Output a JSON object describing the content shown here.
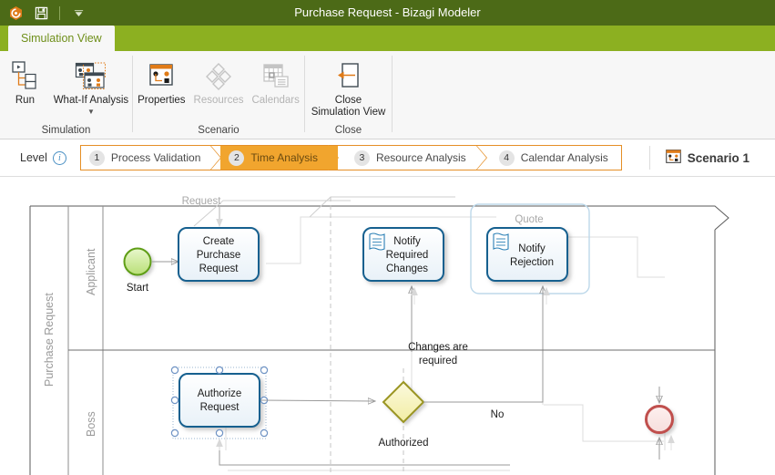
{
  "window": {
    "title": "Purchase Request - Bizagi Modeler",
    "quick_access": [
      {
        "name": "app-logo-icon",
        "label": "Bizagi"
      },
      {
        "name": "save-icon",
        "label": "Save"
      },
      {
        "name": "customize-qat-icon",
        "label": "Customize Quick Access Toolbar"
      }
    ]
  },
  "tabs": [
    {
      "label": "Simulation View",
      "active": true
    }
  ],
  "ribbon": {
    "groups": [
      {
        "label": "Simulation",
        "buttons": [
          {
            "label": "Run",
            "icon": "run-icon",
            "enabled": true,
            "dropdown": false
          },
          {
            "label": "What-If Analysis",
            "icon": "what-if-analysis-icon",
            "enabled": true,
            "dropdown": true
          }
        ]
      },
      {
        "label": "Scenario",
        "buttons": [
          {
            "label": "Properties",
            "icon": "properties-icon",
            "enabled": true,
            "dropdown": false
          },
          {
            "label": "Resources",
            "icon": "resources-icon",
            "enabled": false,
            "dropdown": false
          },
          {
            "label": "Calendars",
            "icon": "calendars-icon",
            "enabled": false,
            "dropdown": false
          }
        ]
      },
      {
        "label": "Close",
        "buttons": [
          {
            "label": "Close\nSimulation View",
            "line1": "Close",
            "line2": "Simulation View",
            "icon": "close-simulation-view-icon",
            "enabled": true,
            "dropdown": false
          }
        ]
      }
    ]
  },
  "level_bar": {
    "label": "Level",
    "info_icon": "info-icon",
    "steps": [
      {
        "num": "1",
        "label": "Process Validation",
        "active": false
      },
      {
        "num": "2",
        "label": "Time Analysis",
        "active": true
      },
      {
        "num": "3",
        "label": "Resource Analysis",
        "active": false
      },
      {
        "num": "4",
        "label": "Calendar Analysis",
        "active": false
      }
    ],
    "scenario": {
      "icon": "scenario-icon",
      "label": "Scenario 1"
    }
  },
  "diagram": {
    "pool": {
      "name": "Purchase Request"
    },
    "lanes": [
      {
        "name": "Applicant"
      },
      {
        "name": "Boss"
      }
    ],
    "groups": [
      {
        "name": "Request"
      },
      {
        "name": "Quote"
      }
    ],
    "events": [
      {
        "name": "Start",
        "label": "Start",
        "type": "start",
        "color": "#9fd14a"
      },
      {
        "name": "End",
        "label": "",
        "type": "end",
        "color": "#c0504d"
      }
    ],
    "tasks": [
      {
        "name": "Create Purchase Request",
        "lines": [
          "Create",
          "Purchase",
          "Request"
        ],
        "type": "user",
        "selected": false
      },
      {
        "name": "Notify Required Changes",
        "lines": [
          "Notify",
          "Required",
          "Changes"
        ],
        "type": "script",
        "selected": false
      },
      {
        "name": "Notify Rejection",
        "lines": [
          "Notify",
          "Rejection"
        ],
        "type": "script",
        "selected": false
      },
      {
        "name": "Authorize Request",
        "lines": [
          "Authorize",
          "Request"
        ],
        "type": "user",
        "selected": true
      }
    ],
    "gateways": [
      {
        "name": "Authorized",
        "label": "Authorized",
        "type": "exclusive",
        "color": "#f5f0b0"
      }
    ],
    "flow_labels": [
      {
        "text": "Changes are",
        "line2": "required"
      },
      {
        "text": "No"
      }
    ]
  },
  "colors": {
    "titlebar": "#4c6a17",
    "tabstrip": "#8cb021",
    "accent_orange": "#e58f26",
    "step_active": "#f1a52e",
    "task_border": "#12608f",
    "task_fill": "#f4f9fd"
  }
}
